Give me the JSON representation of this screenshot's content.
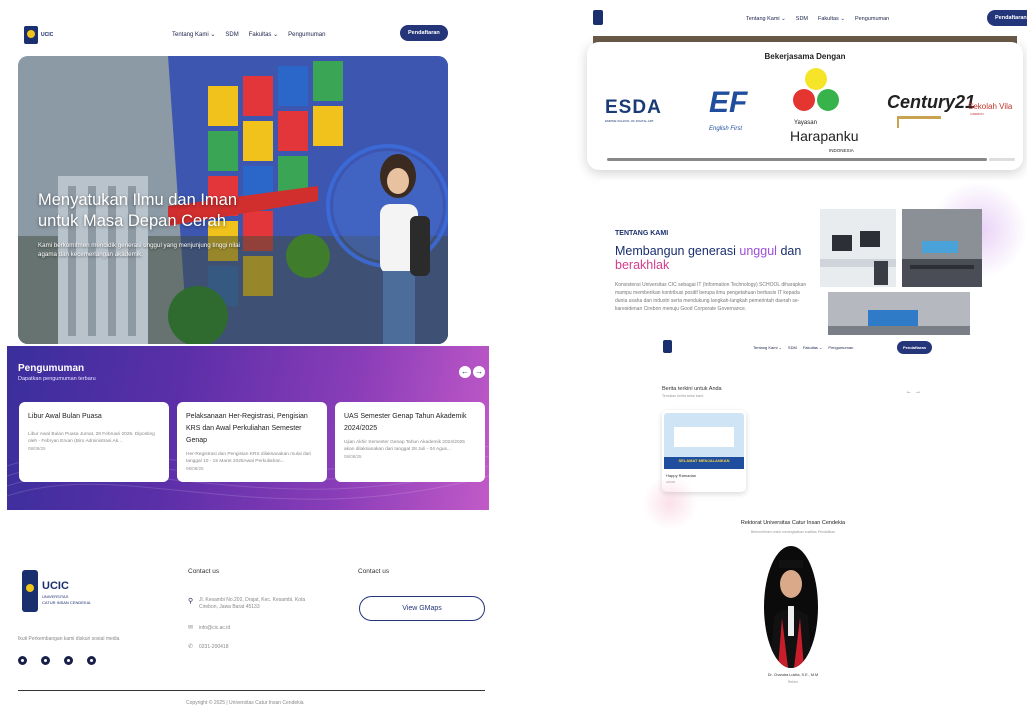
{
  "hero_page": {
    "nav": {
      "logo_text": "UCIC",
      "items": [
        "Tentang Kami ⌄",
        "SDM",
        "Fakultas ⌄",
        "Pengumuman"
      ],
      "cta": "Pendaftaran"
    },
    "title": "Menyatukan Ilmu dan Iman untuk Masa Depan Cerah",
    "subtitle": "Kami berkomitmen mendidik generasi unggul yang menjunjung tinggi nilai agama dan kecemerlangan akademik."
  },
  "pengumuman": {
    "title": "Pengumuman",
    "subtitle": "Dapatkan pengumuman terbaru",
    "prev": "←",
    "next": "→",
    "cards": [
      {
        "title": "Libur Awal Bulan Puasa",
        "body": "Libur Awal Bulan Puasa Jumat, 28 Februari 2025. Diposting oleh - Febryan Ervan (Biro Administrasi Ak...",
        "date": "08/08/25"
      },
      {
        "title": "Pelaksanaan Her-Registrasi, Pengisian KRS dan Awal Perkuliahan Semester Genap",
        "body": "Her-Registrasi dan Pengisian KRS dilaksanakan mulai dari tanggal 10 - 15 Maret 2025Awal Perkuliahan...",
        "date": "08/08/25"
      },
      {
        "title": "UAS Semester Genap Tahun Akademik 2024/2025",
        "body": "Ujian Akhir Semester Genap Tahun Akademik 2024/2025 akan dilaksanakan dari tanggal 28 Juli - 04 Agus...",
        "date": "08/08/25"
      }
    ]
  },
  "footer": {
    "logo_title": "UCIC",
    "logo_sub1": "UNIVERSITAS",
    "logo_sub2": "CATUR INSAN CENDEKIA",
    "social_caption": "Ikuti Perkembangan kami diskuri sosial media",
    "contact_heading_1": "Contact us",
    "contact_heading_2": "Contact us",
    "address": "Jl. Kesambi No.202, Drajat, Kec. Kesambi, Kota Cirebon, Jawa Barat 45133",
    "email": "info@cic.ac.id",
    "phone": "0231-200418",
    "gmaps_button": "View GMaps",
    "copyright": "Copyright © 2025 | Universitas Catur Insan Cendekia"
  },
  "partners_page": {
    "nav": {
      "items": [
        "Tentang Kami ⌄",
        "SDM",
        "Fakultas ⌄",
        "Pengumuman"
      ],
      "cta": "Pendaftaran"
    },
    "heading": "Bekerjasama Dengan",
    "logos": {
      "esda": "ESDA",
      "esda_sub": "EMPIRE SCHOOL OF DIGITAL ART",
      "ef": "EF",
      "ef_sub": "English First",
      "yayasan": "Yayasan",
      "harapanku": "Harapanku",
      "indonesia": "INDONESIA",
      "century": "Century21",
      "sekolah": "Sekolah Vila",
      "sekolah_sub": "CIREBON"
    }
  },
  "tentang": {
    "label": "TENTANG KAMI",
    "title_1": "Membangun generasi",
    "title_highlight": "unggul",
    "title_2": "dan",
    "title_3": "berakhlak",
    "body": "Konsistensi Universitas CIC sebagai IT (Information Technology) SCHOOL diharapkan mampu memberikan kontribusi positif berupa ilmu pengetahuan berbasis IT kepada dunia usaha dan industri serta mendukung langkah-langkah pemerintah daerah se-karesidenan Cirebon menuju Good Corporate Governance."
  },
  "berita": {
    "nav": {
      "items": [
        "Tentang Kami ⌄",
        "SDM",
        "Fakultas ⌄",
        "Pengumuman"
      ],
      "cta": "Pendaftaran"
    },
    "title": "Berita terkini untuk Anda",
    "subtitle": "Temukan berita seksi kami",
    "prev": "←",
    "next": "→",
    "card_title": "Happy Ramadan",
    "card_date": "2/2025",
    "card_banner": "SELAMAT MENJALANKAN",
    "rektor_heading": "Rektorat Universitas Catur Insan Cendekia",
    "rektor_sub": "Berkomitmen untuk meningkatkan kualitas Pendidikan",
    "rektor_name": "Dr. Chandra Lukita, S.E., M.M",
    "rektor_role": "Rektor"
  },
  "colors": {
    "navy": "#24357a",
    "purple_accent": "#9b4fd6",
    "pink_accent": "#d43c8c"
  }
}
